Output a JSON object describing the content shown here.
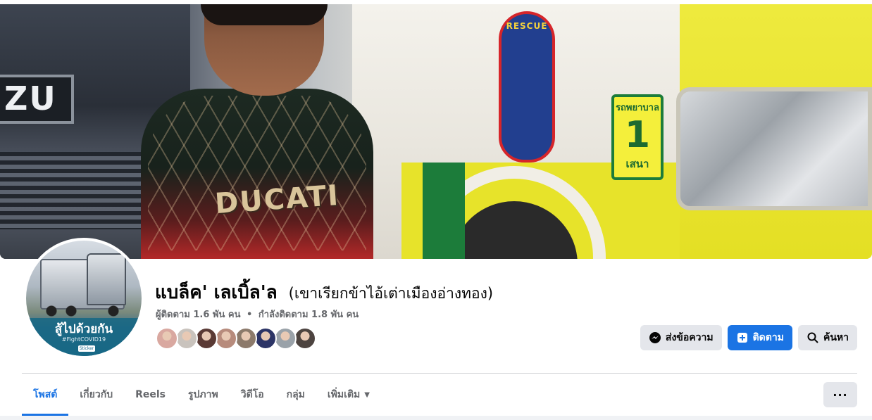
{
  "profile": {
    "name": "แบล็ค' เลเบิ้ล'ล",
    "alternate_name": "(เขาเรียกข้าไอ้เต่าเมืองอ่างทอง)",
    "followers_label": "ผู้ติดตาม 1.6 พัน คน",
    "separator": "•",
    "following_label": "กำลังติดตาม 1.8 พัน คน"
  },
  "cover": {
    "plate_text": "ZU",
    "shield_text": "RESCUE",
    "sign_top": "รถพยาบาล",
    "sign_number": "1",
    "sign_bottom": "เสนา",
    "shirt_text": "DUCATI"
  },
  "avatar": {
    "title": "สู้ไปด้วยกัน",
    "tag": "#FightCOVID19",
    "logo": "Sticker"
  },
  "friends": [
    {
      "icon": "friend-avatar",
      "color": "#d9a8a0"
    },
    {
      "icon": "friend-avatar",
      "color": "#c9c3bd"
    },
    {
      "icon": "friend-avatar",
      "color": "#5a3a35"
    },
    {
      "icon": "friend-avatar",
      "color": "#b78b7c"
    },
    {
      "icon": "friend-avatar",
      "color": "#8c7a6b"
    },
    {
      "icon": "friend-avatar",
      "color": "#2c3466"
    },
    {
      "icon": "friend-avatar",
      "color": "#9aa2a9"
    },
    {
      "icon": "friend-avatar",
      "color": "#4d4440"
    }
  ],
  "actions": {
    "message_label": "ส่งข้อความ",
    "follow_label": "ติดตาม",
    "search_label": "ค้นหา"
  },
  "tabs": [
    {
      "label": "โพสต์",
      "active": true
    },
    {
      "label": "เกี่ยวกับ",
      "active": false
    },
    {
      "label": "Reels",
      "active": false
    },
    {
      "label": "รูปภาพ",
      "active": false
    },
    {
      "label": "วิดีโอ",
      "active": false
    },
    {
      "label": "กลุ่ม",
      "active": false
    },
    {
      "label": "เพิ่มเติม",
      "active": false
    }
  ],
  "more_menu": "···",
  "colors": {
    "accent": "#1b74e4",
    "secondary_text": "#65676b",
    "button_grey": "#e4e6eb"
  }
}
